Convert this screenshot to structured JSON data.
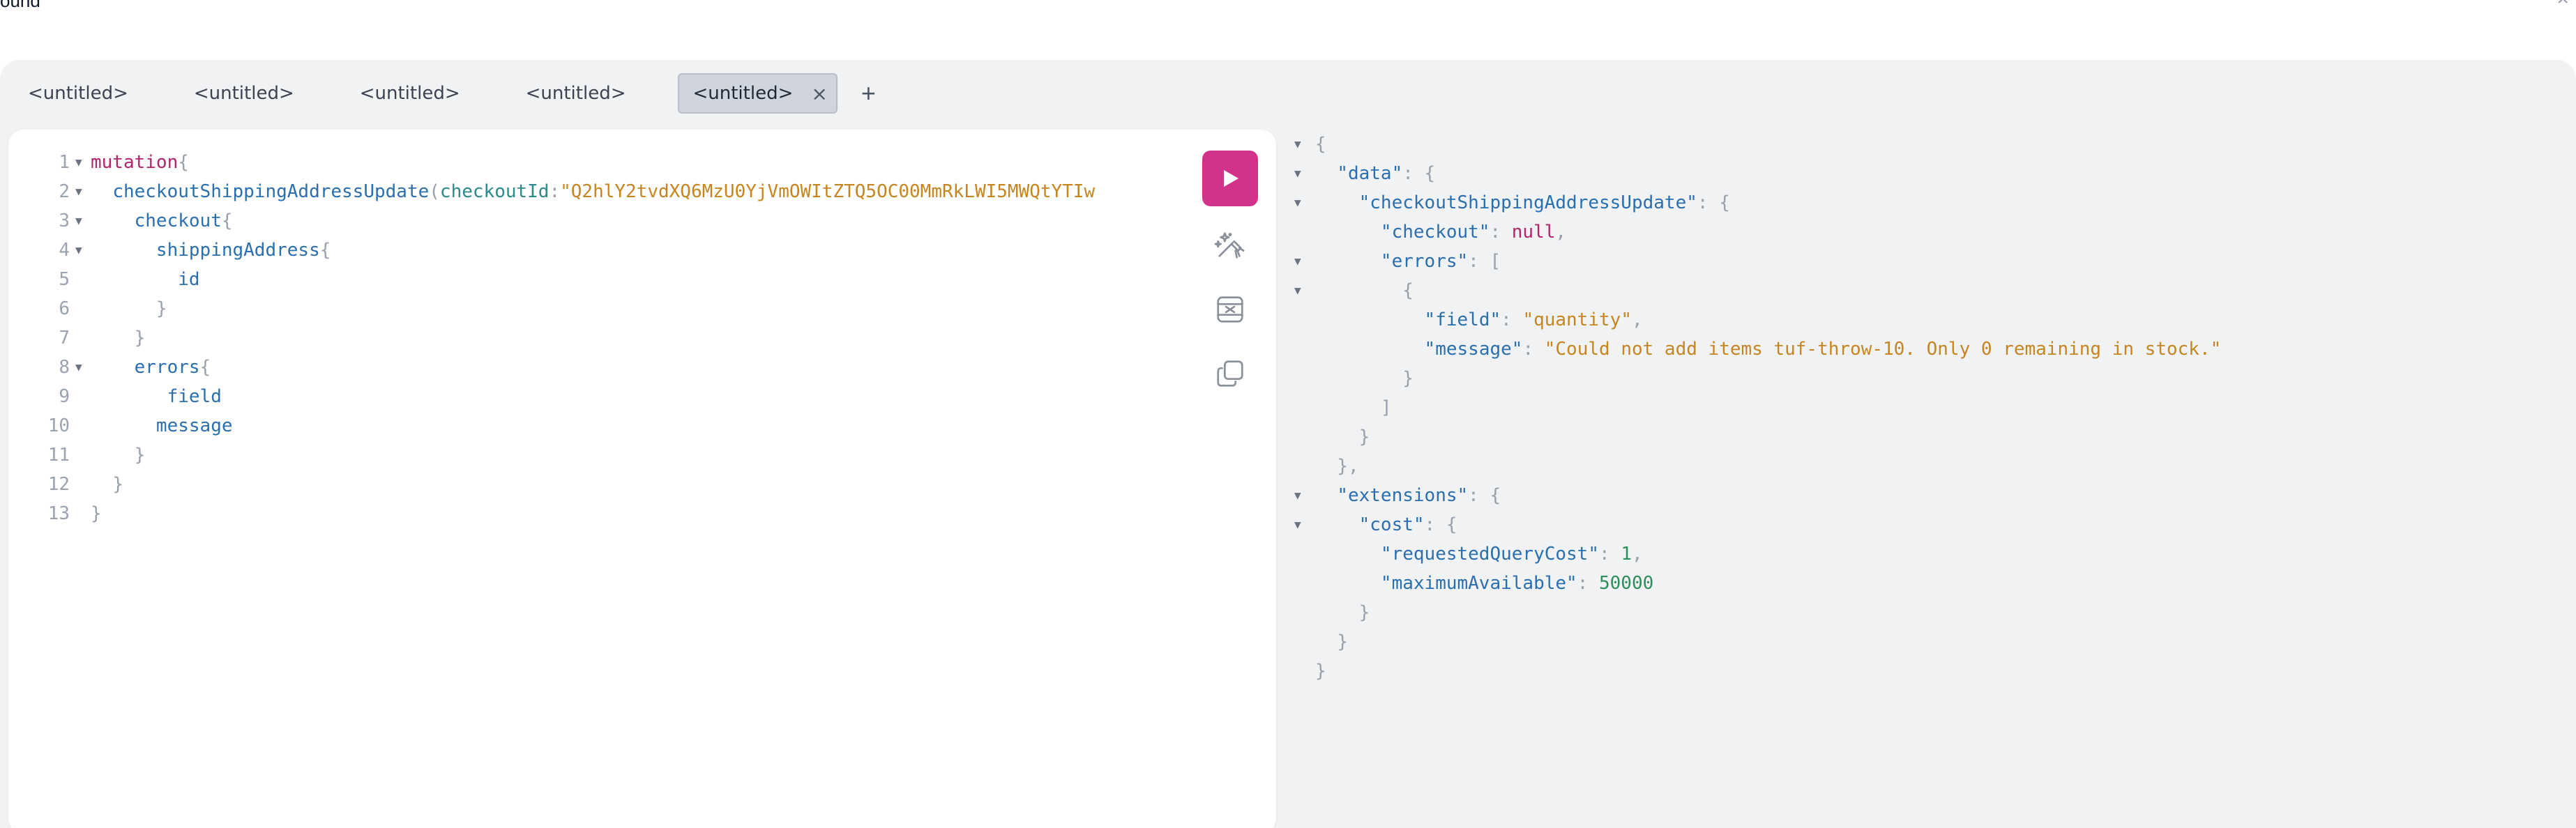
{
  "window": {
    "title_fragment": "ound",
    "close_glyph": "×"
  },
  "tabs": [
    {
      "label": "<untitled>",
      "active": false
    },
    {
      "label": "<untitled>",
      "active": false
    },
    {
      "label": "<untitled>",
      "active": false
    },
    {
      "label": "<untitled>",
      "active": false
    },
    {
      "label": "<untitled>",
      "active": true
    }
  ],
  "tab_close_glyph": "×",
  "add_tab_glyph": "+",
  "editor": {
    "line_numbers": [
      "1",
      "2",
      "3",
      "4",
      "5",
      "6",
      "7",
      "8",
      "9",
      "10",
      "11",
      "12",
      "13"
    ],
    "lines": {
      "l1_kw": "mutation",
      "l1_brace": "{",
      "l2_fn": "checkoutShippingAddressUpdate",
      "l2_paren": "(",
      "l2_arg": "checkoutId",
      "l2_colon": ":",
      "l2_str": "\"Q2hlY2tvdXQ6MzU0YjVmOWItZTQ5OC00MmRkLWI5MWQtYTIw",
      "l3_fld": "checkout",
      "l3_brace": "{",
      "l4_fld": "shippingAddress",
      "l4_brace": "{",
      "l5_fld": "id",
      "l6_brace": "}",
      "l7_brace": "}",
      "l8_fld": "errors",
      "l8_brace": "{",
      "l9_fld": "field",
      "l10_fld": "message",
      "l11_brace": "}",
      "l12_brace": "}",
      "l13_brace": "}"
    }
  },
  "toolbar": {
    "run_icon": "play-icon",
    "prettify_icon": "magic-wand-icon",
    "merge_icon": "merge-fragments-icon",
    "copy_icon": "copy-icon",
    "run_color": "#d23289"
  },
  "result": {
    "open_brace": "{",
    "data_key": "\"data\"",
    "update_key": "\"checkoutShippingAddressUpdate\"",
    "checkout_key": "\"checkout\"",
    "checkout_val": "null",
    "errors_key": "\"errors\"",
    "error_field_key": "\"field\"",
    "error_field_val": "\"quantity\"",
    "error_message_key": "\"message\"",
    "error_message_val": "\"Could not add items tuf-throw-10. Only 0 remaining in stock.\"",
    "extensions_key": "\"extensions\"",
    "cost_key": "\"cost\"",
    "requested_key": "\"requestedQueryCost\"",
    "requested_val": "1",
    "maximum_key": "\"maximumAvailable\"",
    "maximum_val": "50000",
    "colon_obj": ": {",
    "colon_arr": ": [",
    "colon": ": ",
    "comma": ",",
    "obj_open": "{",
    "obj_close": "}",
    "obj_close_comma": "},",
    "arr_close": "]"
  }
}
